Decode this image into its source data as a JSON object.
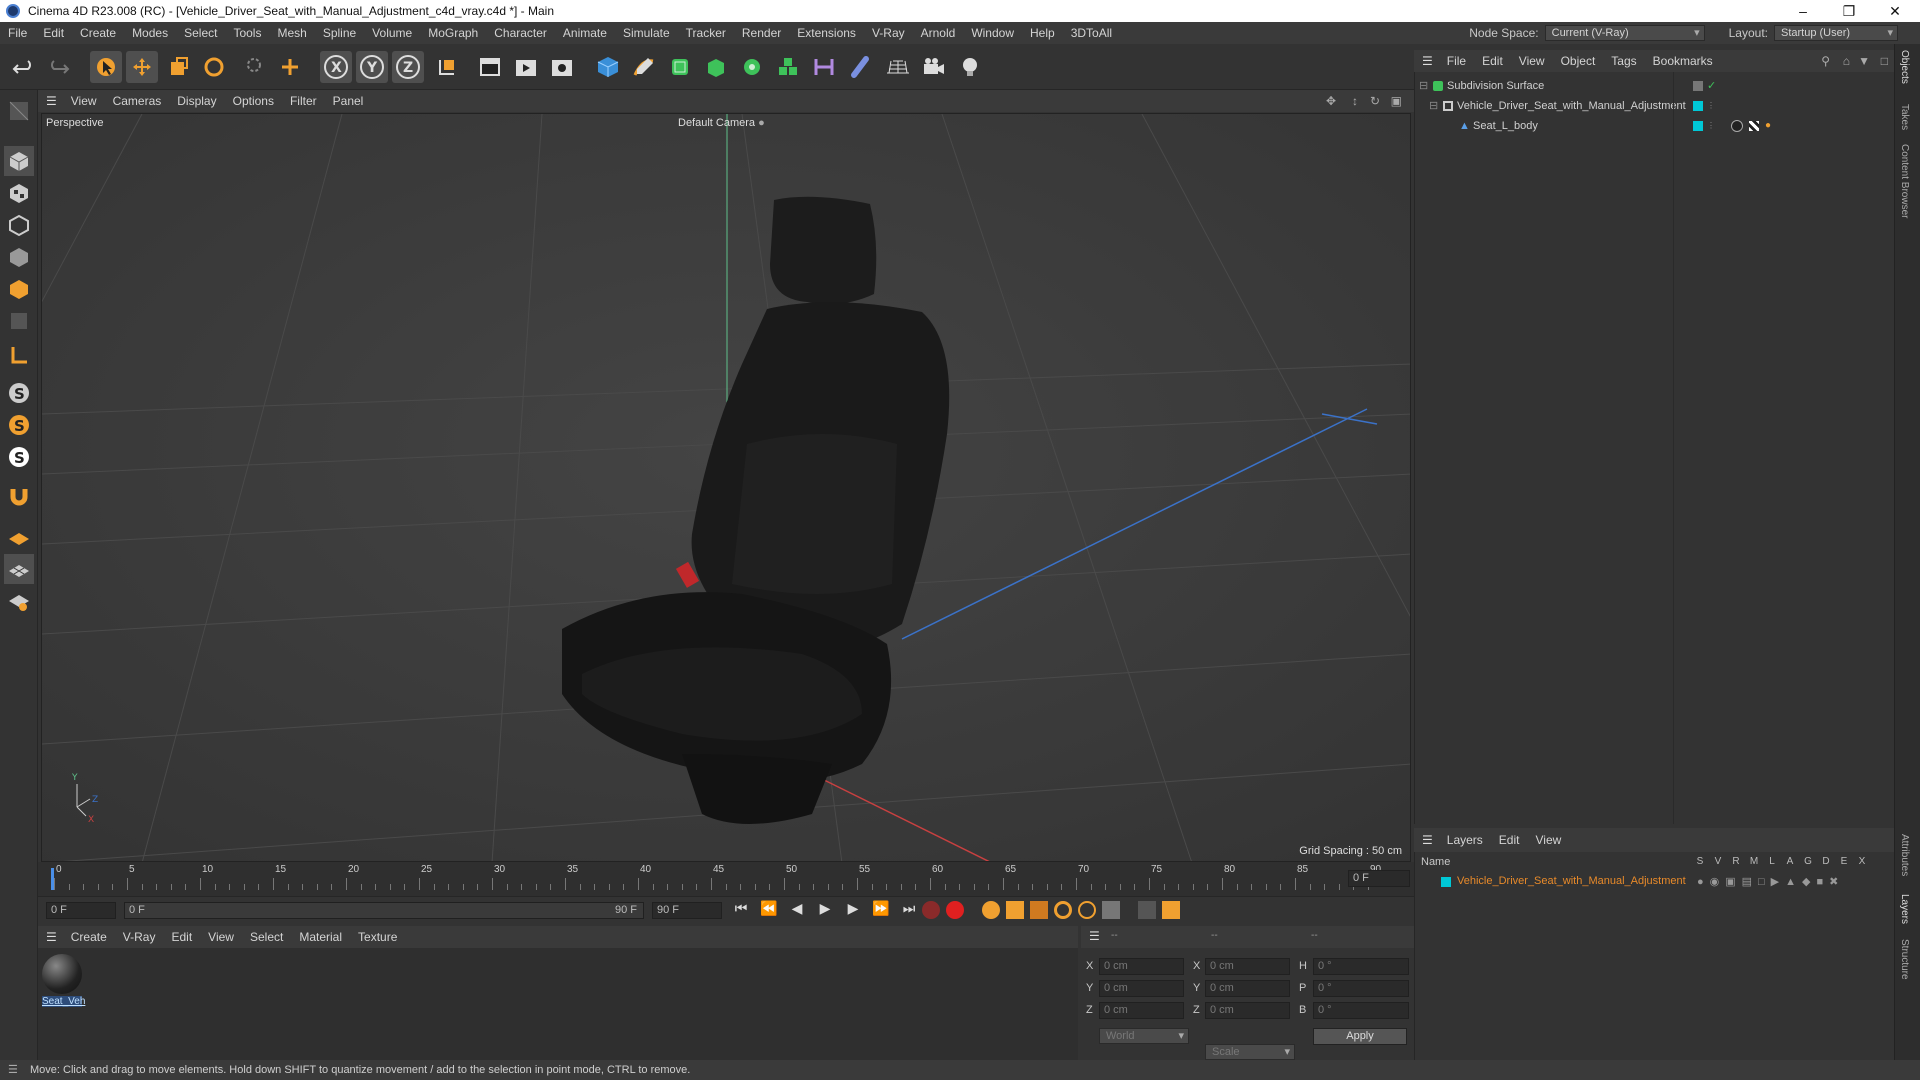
{
  "title": "Cinema 4D R23.008 (RC) - [Vehicle_Driver_Seat_with_Manual_Adjustment_c4d_vray.c4d *] - Main",
  "menu": [
    "File",
    "Edit",
    "Create",
    "Modes",
    "Select",
    "Tools",
    "Mesh",
    "Spline",
    "Volume",
    "MoGraph",
    "Character",
    "Animate",
    "Simulate",
    "Tracker",
    "Render",
    "Extensions",
    "V-Ray",
    "Arnold",
    "Window",
    "Help",
    "3DToAll"
  ],
  "node_space_label": "Node Space:",
  "node_space_value": "Current (V-Ray)",
  "layout_label": "Layout:",
  "layout_value": "Startup (User)",
  "viewport_menu": [
    "View",
    "Cameras",
    "Display",
    "Options",
    "Filter",
    "Panel"
  ],
  "viewport_label": "Perspective",
  "camera_label": "Default Camera",
  "grid_spacing": "Grid Spacing : 50 cm",
  "timeline_ticks": [
    "0",
    "5",
    "10",
    "15",
    "20",
    "25",
    "30",
    "35",
    "40",
    "45",
    "50",
    "55",
    "60",
    "65",
    "70",
    "75",
    "80",
    "85",
    "90"
  ],
  "frame_current": "0 F",
  "frame_start": "0 F",
  "frame_range_start": "0 F",
  "frame_range_end": "90 F",
  "frame_end": "90 F",
  "material_menu": [
    "Create",
    "V-Ray",
    "Edit",
    "View",
    "Select",
    "Material",
    "Texture"
  ],
  "material_name": "Seat_Veh",
  "coord_headers": [
    "--",
    "--",
    "--"
  ],
  "coords": {
    "x_label": "X",
    "y_label": "Y",
    "z_label": "Z",
    "h_label": "H",
    "p_label": "P",
    "b_label": "B",
    "x_pos": "0 cm",
    "y_pos": "0 cm",
    "z_pos": "0 cm",
    "x_size": "0 cm",
    "y_size": "0 cm",
    "z_size": "0 cm",
    "h": "0 °",
    "p": "0 °",
    "b": "0 °"
  },
  "coord_system": "World",
  "coord_mode": "Scale",
  "apply_label": "Apply",
  "object_menu": [
    "File",
    "Edit",
    "View",
    "Object",
    "Tags",
    "Bookmarks"
  ],
  "objects": [
    {
      "name": "Subdivision Surface",
      "indent": 0
    },
    {
      "name": "Vehicle_Driver_Seat_with_Manual_Adjustment",
      "indent": 1
    },
    {
      "name": "Seat_L_body",
      "indent": 2
    }
  ],
  "layers_menu": [
    "Layers",
    "Edit",
    "View"
  ],
  "layers_header_name": "Name",
  "layers_columns": [
    "S",
    "V",
    "R",
    "M",
    "L",
    "A",
    "G",
    "D",
    "E",
    "X"
  ],
  "layer_name": "Vehicle_Driver_Seat_with_Manual_Adjustment",
  "side_tabs": [
    "Objects",
    "Takes",
    "Content Browser",
    "Attributes",
    "Layers",
    "Structure"
  ],
  "status": "Move: Click and drag to move elements. Hold down SHIFT to quantize movement / add to the selection in point mode, CTRL to remove.",
  "colors": {
    "accent": "#00c8d6",
    "layer_text": "#e88a2a",
    "axis_x": "#c84040",
    "axis_y": "#5fc08a",
    "axis_z": "#3b72c8"
  }
}
